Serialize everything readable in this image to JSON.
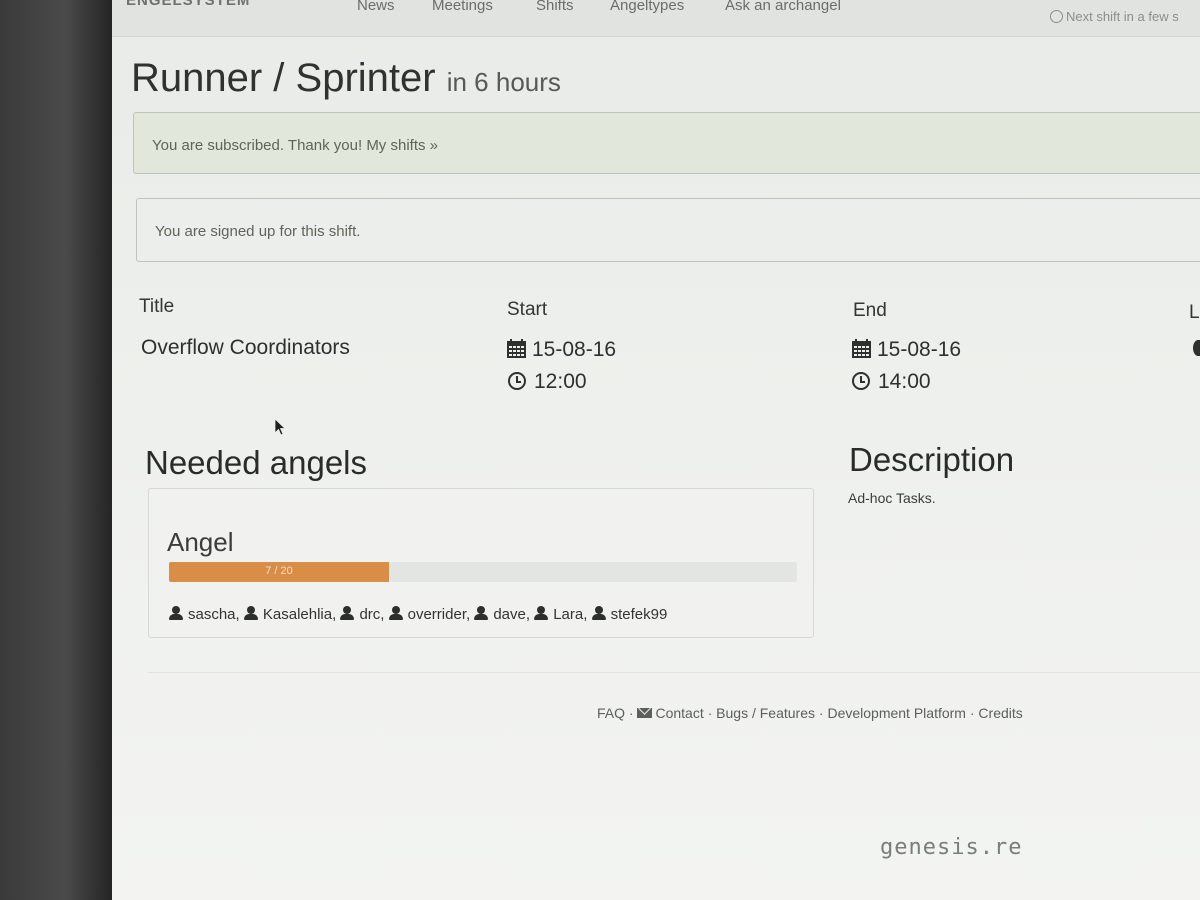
{
  "navbar": {
    "brand": "ENGELSYSTEM",
    "links": [
      "News",
      "Meetings",
      "Shifts",
      "Angeltypes",
      "Ask an archangel"
    ],
    "next_shift": "Next shift in a few s"
  },
  "page": {
    "title": "Runner / Sprinter",
    "title_suffix": "in 6 hours"
  },
  "alerts": {
    "subscribed": "You are subscribed. Thank you!",
    "my_shifts_link": "My shifts »",
    "signed_up": "You are signed up for this shift."
  },
  "shift": {
    "title_label": "Title",
    "title_value": "Overflow Coordinators",
    "start_label": "Start",
    "start_date": "15-08-16",
    "start_time": "12:00",
    "end_label": "End",
    "end_date": "15-08-16",
    "end_time": "14:00",
    "location_label_partial": "L"
  },
  "needed_angels": {
    "heading": "Needed angels",
    "angeltype": "Angel",
    "progress_text": "7 / 20",
    "filled": 7,
    "needed": 20,
    "names": [
      "sascha",
      "Kasalehlia",
      "drc",
      "overrider",
      "dave",
      "Lara",
      "stefek99"
    ]
  },
  "description": {
    "heading": "Description",
    "text": "Ad-hoc Tasks."
  },
  "footer": {
    "faq": "FAQ",
    "contact": "Contact",
    "bugs": "Bugs / Features",
    "dev_platform": "Development Platform",
    "credits": "Credits",
    "separator": "·"
  },
  "watermark": "genesis.re",
  "colors": {
    "progress_warning": "#d98e48",
    "alert_success_bg": "#e1e7da"
  }
}
